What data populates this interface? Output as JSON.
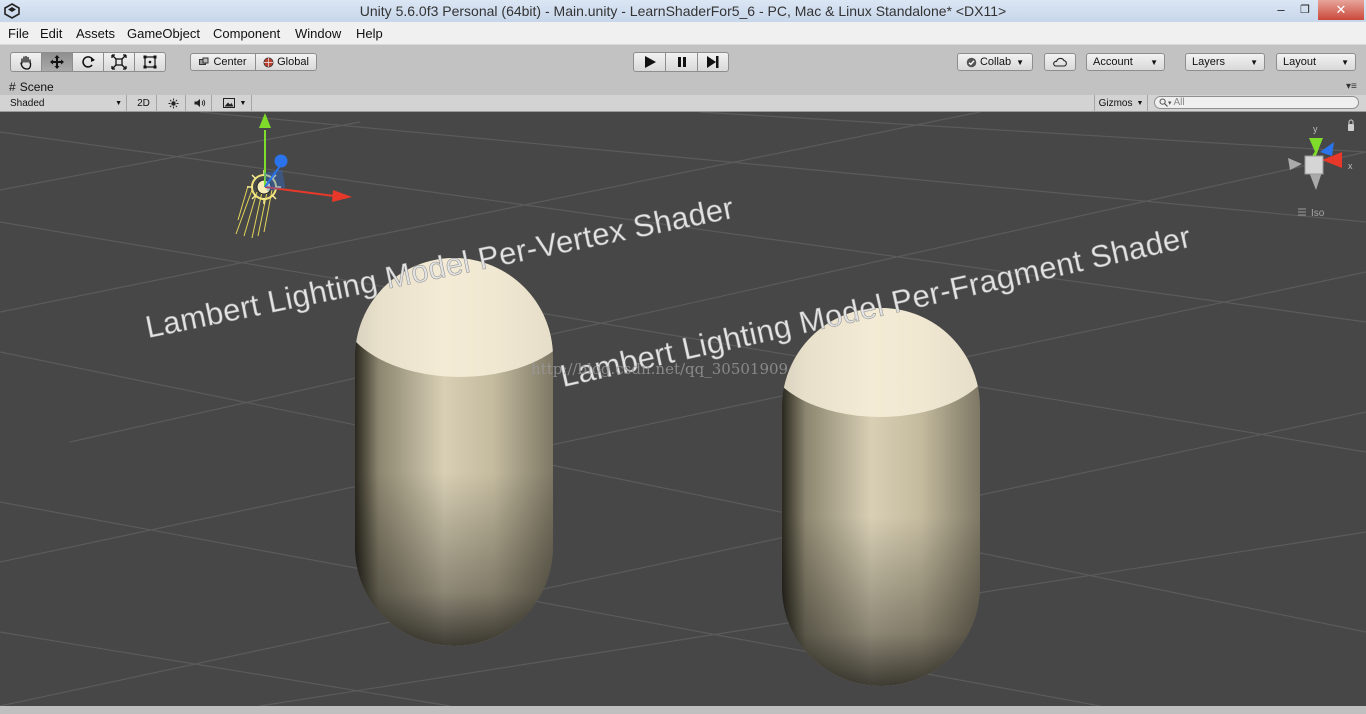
{
  "window": {
    "title": "Unity 5.6.0f3 Personal (64bit) - Main.unity - LearnShaderFor5_6 - PC, Mac & Linux Standalone* <DX11>",
    "minimize": "–",
    "maximize": "❐",
    "close": "✕"
  },
  "menu": [
    "File",
    "Edit",
    "Assets",
    "GameObject",
    "Component",
    "Window",
    "Help"
  ],
  "toolbar": {
    "center_label": "Center",
    "global_label": "Global",
    "collab_label": "Collab",
    "account_label": "Account",
    "layers_label": "Layers",
    "layout_label": "Layout"
  },
  "scene": {
    "tab_label": "Scene",
    "draw_mode": "Shaded",
    "mode_2d": "2D",
    "gizmos_label": "Gizmos",
    "search_placeholder": "All",
    "iso_label": "Iso",
    "axis_y": "y",
    "axis_x": "x",
    "text_vertex": "Lambert Lighting Model Per-Vertex Shader",
    "text_fragment": "Lambert Lighting Model Per-Fragment Shader",
    "watermark": "http://blog.csdn.net/qq_30501909"
  },
  "colors": {
    "viewport_bg": "#474747",
    "grid_line": "#5c5c5c",
    "capsule_light": "#fbf4e2",
    "capsule_dark": "#181710",
    "axis_x": "#e8382a",
    "axis_y": "#7fdc2b",
    "axis_z": "#2a73ea"
  }
}
